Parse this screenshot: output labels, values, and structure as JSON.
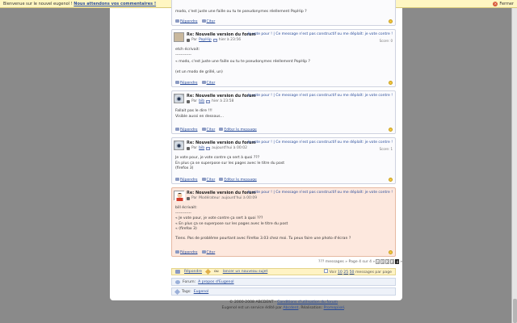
{
  "notification": {
    "welcome": "Bienvenue sur le nouvel eugenol !",
    "link": "Nous attendons vos commentaires !",
    "close_label": "Fermer"
  },
  "top_partial": {
    "body": "modo, c'est juste une faille ou tu te pseudonymes réellement PopHip ?",
    "reply": "Répondre",
    "quote": "Citer"
  },
  "posts": [
    {
      "title_prefix": "Re: ",
      "title": "Nouvelle version du forum",
      "votes": "Je vote pour ! | Ce message n'est pas constructif ou me déplaît: je vote contre !",
      "author_prefix": "Par",
      "author": "PopHip",
      "time": "hier à 23:56",
      "score": "Score: 0",
      "lines": [
        "etch écrivait:",
        "------------",
        "« modo, c'est juste une faille ou tu te pseudonymes réellement PopHip ?",
        "",
        "(et un modo de grillé, un)"
      ],
      "reply": "Répondre",
      "quote": "Citer",
      "edit": ""
    },
    {
      "title_prefix": "Re: ",
      "title": "Nouvelle version du forum",
      "votes": "Je vote pour ! | Ce message n'est pas constructif ou me déplaît: je vote contre !",
      "author_prefix": "Par",
      "author": "bib",
      "time": "hier à 23:58",
      "score": "",
      "lines": [
        "Fallait pas le dire !!!",
        "Visible aussi en dessous..."
      ],
      "reply": "Répondre",
      "quote": "Citer",
      "edit": "Editer le message"
    },
    {
      "title_prefix": "Re: ",
      "title": "Nouvelle version du forum",
      "votes": "Je vote pour ! | Ce message n'est pas constructif ou me déplaît: je vote contre !",
      "author_prefix": "Par",
      "author": "bib",
      "time": "aujourd'hui à 00:02",
      "score": "Score: 1",
      "lines": [
        "Je vote pour, je vote contre ça sert à quoi ???",
        "En plus ça se superpose sur les pages avec le titre du post",
        "(firefox 3)"
      ],
      "reply": "Répondre",
      "quote": "Citer",
      "edit": "Editer le message"
    },
    {
      "title_prefix": "Re: ",
      "title": "Nouvelle version du forum",
      "votes": "Je vote pour ! | Ce message n'est pas constructif ou me déplaît: je vote contre !",
      "author_prefix": "Par",
      "author": "Modérateur",
      "time": "aujourd'hui à 00:09",
      "score": "",
      "lines": [
        "bill écrivait:",
        "------------",
        "« Je vote pour, je vote contre ça sert à quoi ???",
        "« En plus ça se superpose sur les pages avec le titre du post",
        "« (firefox 3)",
        "",
        "Tiens. Pas de problème pourtant avec Firefox 3.03 chez moi. Tu peux faire une photo d'écran ?"
      ],
      "reply": "Répondre",
      "quote": "Citer",
      "edit": ""
    }
  ],
  "pagination": {
    "summary": "??? messages » Page 4 sur 4 »",
    "pages": [
      "1",
      "2",
      "3",
      "4"
    ],
    "current": "4",
    "prev": "«",
    "next": "»"
  },
  "replybar": {
    "reply": "Répondre",
    "or": "ou",
    "new_topic": "lancer un nouveau sujet",
    "see": "Voir",
    "sizes": [
      "10",
      "25",
      "50"
    ],
    "per_page": "messages par page"
  },
  "forum": {
    "label": "Forum:",
    "value": "A propos d'Eugenol"
  },
  "tags": {
    "label": "Tags:",
    "value": "Eugenol"
  },
  "footer": {
    "line1": "© 2000-2008 ABCDENT -",
    "terms": "Conditions d'utilisation du forum",
    "line2": "Eugenol est un service édité par",
    "publisher": "Abcdent",
    "realisation": ". Réalisation:",
    "agency": "Promopixel",
    "dot": "."
  }
}
